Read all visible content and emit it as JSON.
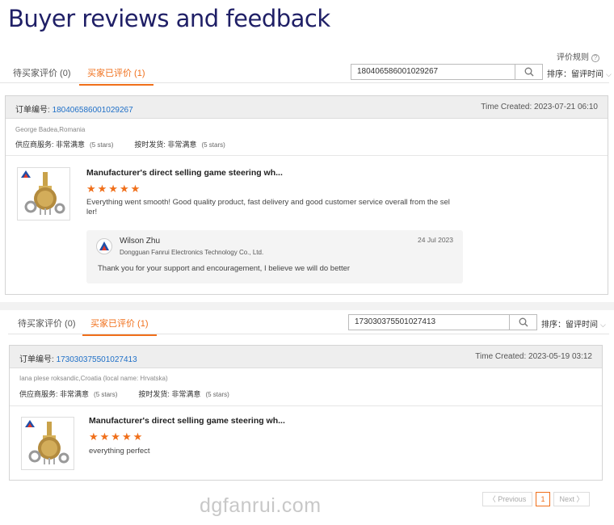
{
  "heading": "Buyer reviews and feedback",
  "rules_link": "评价规则",
  "sections": [
    {
      "tabs": [
        "待买家评价 (0)",
        "买家已评价 (1)"
      ],
      "search_value": "180406586001029267",
      "sort_label": "排序：留评时间",
      "order_label": "订单编号:",
      "order_number": "180406586001029267",
      "time_created": "Time Created: 2023-07-21 06:10",
      "buyer": "George Badea,Romania",
      "supplier_service_label": "供应商服务:",
      "supplier_service_value": "非常满意",
      "supplier_service_stars": "(5 stars)",
      "shipping_label": "按时发货:",
      "shipping_value": "非常满意",
      "shipping_stars": "(5 stars)",
      "product_title": "Manufacturer's direct selling game steering wh...",
      "rating": 5,
      "stars": "★★★★★",
      "comment_line1": "Everything went smooth! Good quality product, fast delivery and good customer service overall from the sel",
      "comment_line2": "ler!",
      "reply": {
        "name": "Wilson Zhu",
        "company": "Dongguan Fanrui Electronics Technology Co., Ltd.",
        "date": "24 Jul 2023",
        "text": "Thank you for your support and encouragement, I believe we will do better"
      }
    },
    {
      "tabs": [
        "待买家评价 (0)",
        "买家已评价 (1)"
      ],
      "search_value": "173030375501027413",
      "sort_label": "排序：留评时间",
      "order_label": "订单编号:",
      "order_number": "173030375501027413",
      "time_created": "Time Created: 2023-05-19 03:12",
      "buyer": "Iana plese roksandic,Croatia (local name: Hrvatska)",
      "supplier_service_label": "供应商服务:",
      "supplier_service_value": "非常满意",
      "supplier_service_stars": "(5 stars)",
      "shipping_label": "按时发货:",
      "shipping_value": "非常满意",
      "shipping_stars": "(5 stars)",
      "product_title": "Manufacturer's direct selling game steering wh...",
      "rating": 5,
      "stars": "★★★★★",
      "comment_line1": "everything perfect"
    }
  ],
  "pagination": {
    "previous": "〈 Previous",
    "current": "1",
    "next": "Next 〉"
  },
  "watermark": "dgfanrui.com",
  "colors": {
    "accent": "#f06f1a",
    "link": "#1e6fc7",
    "heading": "#1f1f66"
  }
}
